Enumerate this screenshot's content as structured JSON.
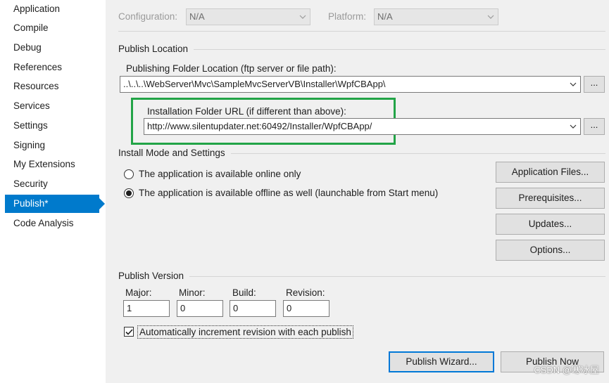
{
  "sidebar": {
    "items": [
      {
        "label": "Application"
      },
      {
        "label": "Compile"
      },
      {
        "label": "Debug"
      },
      {
        "label": "References"
      },
      {
        "label": "Resources"
      },
      {
        "label": "Services"
      },
      {
        "label": "Settings"
      },
      {
        "label": "Signing"
      },
      {
        "label": "My Extensions"
      },
      {
        "label": "Security"
      },
      {
        "label": "Publish*",
        "selected": true
      },
      {
        "label": "Code Analysis"
      }
    ]
  },
  "config_bar": {
    "configuration_label": "Configuration:",
    "configuration_value": "N/A",
    "platform_label": "Platform:",
    "platform_value": "N/A"
  },
  "publish_location": {
    "title": "Publish Location",
    "folder_label": "Publishing Folder Location (ftp server or file path):",
    "folder_value": "..\\..\\..\\WebServer\\Mvc\\SampleMvcServerVB\\Installer\\WpfCBApp\\",
    "browse_label": "...",
    "install_url_label": "Installation Folder URL (if different than above):",
    "install_url_value": "http://www.silentupdater.net:60492/Installer/WpfCBApp/",
    "install_browse_label": "..."
  },
  "install_mode": {
    "title": "Install Mode and Settings",
    "online_only_label": "The application is available online only",
    "offline_label": "The application is available offline as well (launchable from Start menu)",
    "selected": "offline",
    "buttons": {
      "application_files": "Application Files...",
      "prerequisites": "Prerequisites...",
      "updates": "Updates...",
      "options": "Options..."
    }
  },
  "publish_version": {
    "title": "Publish Version",
    "major_label": "Major:",
    "major_value": "1",
    "minor_label": "Minor:",
    "minor_value": "0",
    "build_label": "Build:",
    "build_value": "0",
    "revision_label": "Revision:",
    "revision_value": "0",
    "auto_increment_label": "Automatically increment revision with each publish",
    "auto_increment_checked": true
  },
  "actions": {
    "publish_wizard": "Publish Wizard...",
    "publish_now": "Publish Now"
  },
  "watermark": "CSDN @寒冰屋",
  "colors": {
    "accent": "#007acc",
    "highlight_box": "#22a447"
  }
}
